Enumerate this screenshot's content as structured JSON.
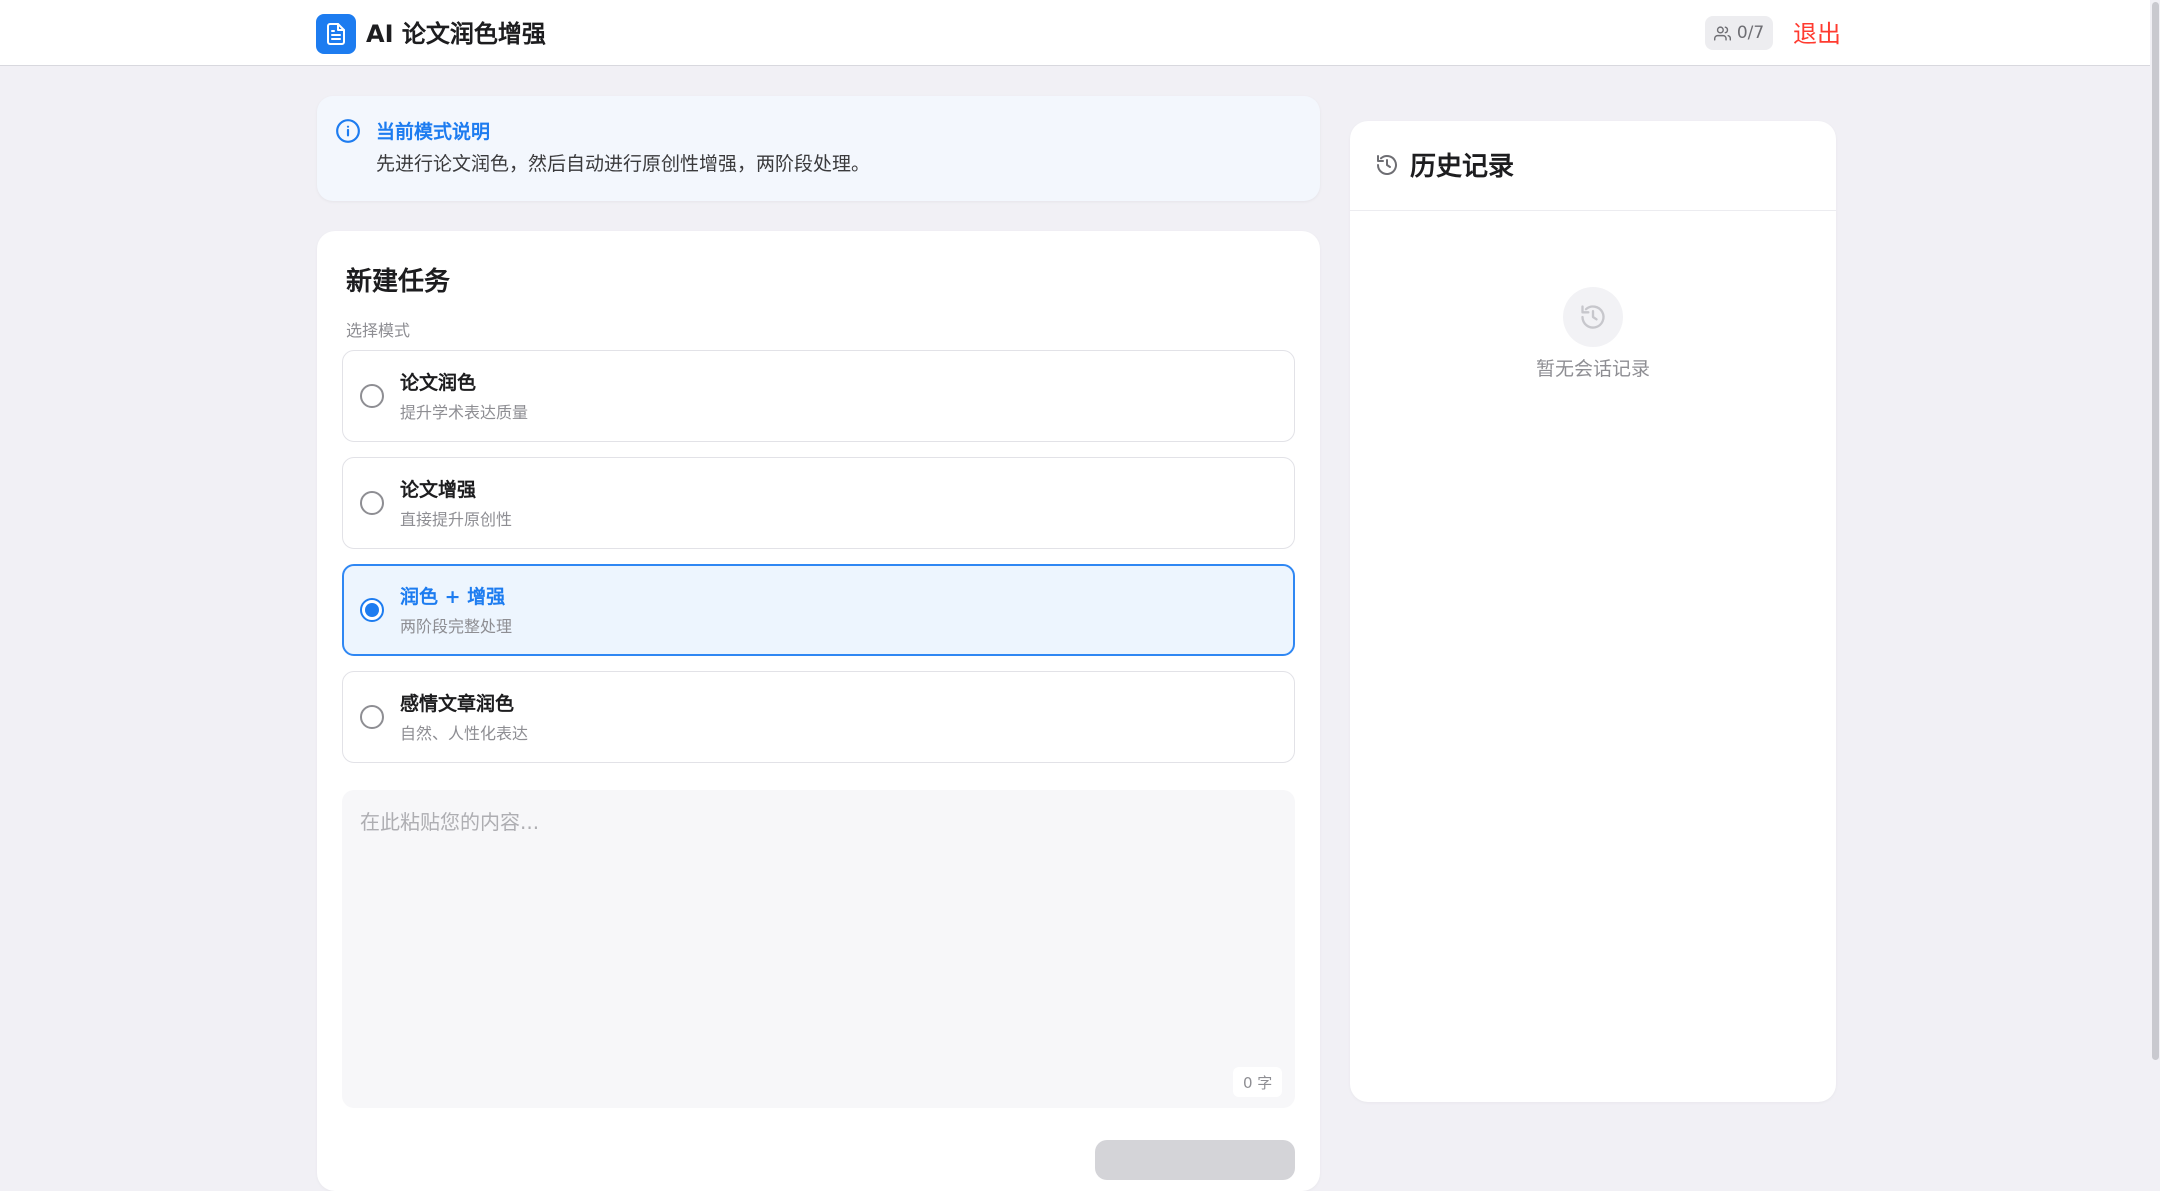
{
  "header": {
    "app_title": "AI 论文润色增强",
    "user_count": "0/7",
    "logout_label": "退出"
  },
  "info": {
    "title": "当前模式说明",
    "description": "先进行论文润色，然后自动进行原创性增强，两阶段处理。"
  },
  "task": {
    "title": "新建任务",
    "mode_label": "选择模式",
    "options": [
      {
        "title": "论文润色",
        "desc": "提升学术表达质量",
        "selected": false
      },
      {
        "title": "论文增强",
        "desc": "直接提升原创性",
        "selected": false
      },
      {
        "title": "润色 + 增强",
        "desc": "两阶段完整处理",
        "selected": true
      },
      {
        "title": "感情文章润色",
        "desc": "自然、人性化表达",
        "selected": false
      }
    ],
    "input_placeholder": "在此粘贴您的内容...",
    "input_value": "",
    "char_count": "0 字"
  },
  "history": {
    "title": "历史记录",
    "empty_text": "暂无会话记录"
  },
  "colors": {
    "accent": "#1d7cf0",
    "logout": "#ff3b30",
    "background": "#f1f0f5"
  },
  "icons": {
    "logo": "document-icon",
    "users": "users-icon",
    "info": "info-icon",
    "history": "history-icon"
  }
}
